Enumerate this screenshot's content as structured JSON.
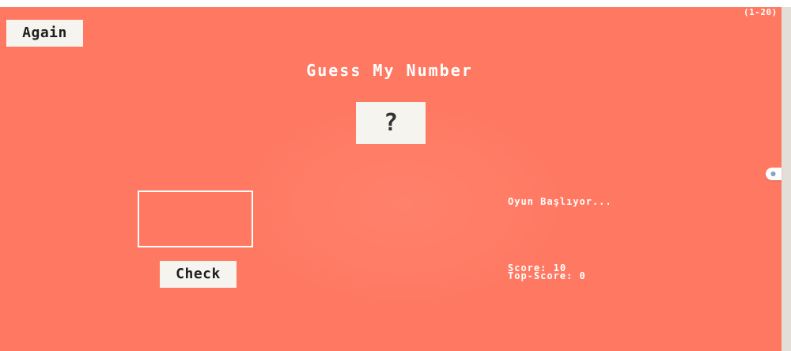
{
  "game": {
    "range_text": "(1-20)",
    "again_label": "Again",
    "title": "Guess My Number",
    "secret_display": "?",
    "guess_value": "",
    "check_label": "Check",
    "message": "Oyun Başlıyor...",
    "score_label": "Score:",
    "score_value": "10",
    "top_score_label": "Top-Score:",
    "top_score_value": "0"
  },
  "colors": {
    "background": "#ff7962",
    "button_bg": "#f6f4ef",
    "text_light": "#ffffff",
    "text_dark": "#1e1e1e"
  },
  "icons": {
    "scrollbar_thumb": "scroll-thumb-icon"
  }
}
